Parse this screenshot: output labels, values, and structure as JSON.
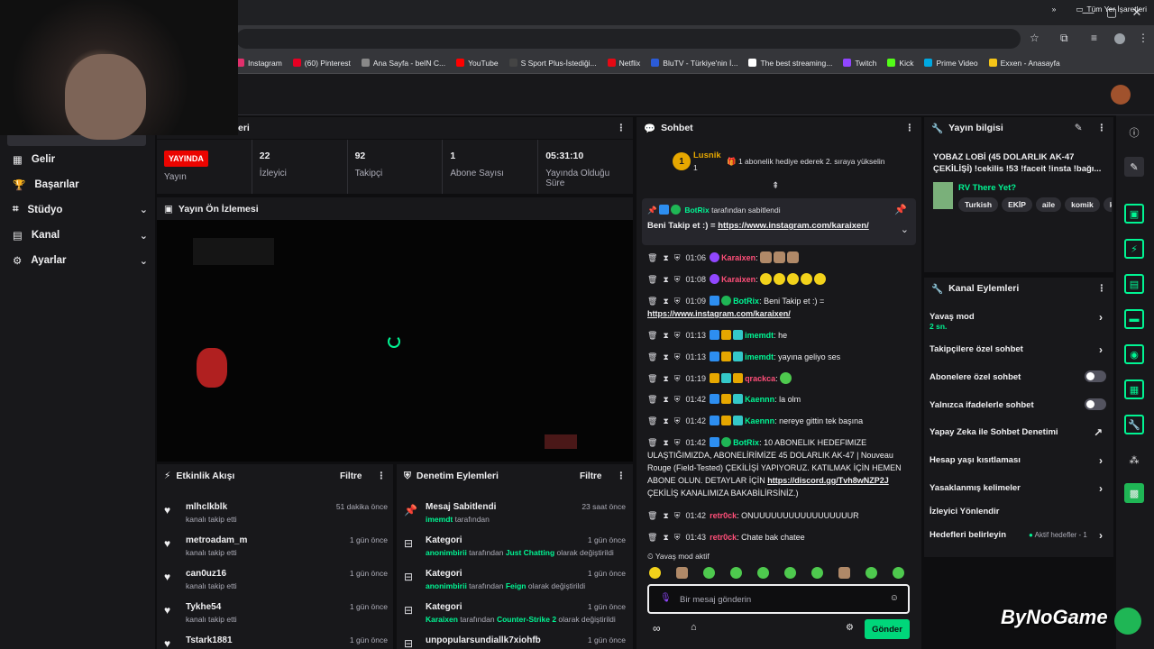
{
  "browser": {
    "bookmarks": [
      {
        "label": "Instagram",
        "color": "#e1306c"
      },
      {
        "label": "(60) Pinterest",
        "color": "#e60023"
      },
      {
        "label": "Ana Sayfa - beIN C...",
        "color": "#888888"
      },
      {
        "label": "YouTube",
        "color": "#ff0000"
      },
      {
        "label": "S Sport Plus-İstediği...",
        "color": "#444444"
      },
      {
        "label": "Netflix",
        "color": "#e50914"
      },
      {
        "label": "BluTV - Türkiye'nin İ...",
        "color": "#2b5bd7"
      },
      {
        "label": "The best streaming...",
        "color": "#ffffff"
      },
      {
        "label": "Twitch",
        "color": "#9146ff"
      },
      {
        "label": "Kick",
        "color": "#53fc18"
      },
      {
        "label": "Prime Video",
        "color": "#00a8e1"
      },
      {
        "label": "Exxen - Anasayfa",
        "color": "#f5c518"
      }
    ],
    "bookmarks_more": "»",
    "all_bookmarks": "Tüm Yer İşaretleri"
  },
  "sidebar": {
    "items": [
      {
        "label": "Gelir",
        "icon": "income-icon",
        "chevron": false
      },
      {
        "label": "Başarılar",
        "icon": "trophy-icon",
        "chevron": false
      },
      {
        "label": "Stüdyo",
        "icon": "studio-icon",
        "chevron": true
      },
      {
        "label": "Kanal",
        "icon": "channel-icon",
        "chevron": true
      },
      {
        "label": "Ayarlar",
        "icon": "settings-icon",
        "chevron": true
      }
    ]
  },
  "stream_panel": {
    "title_fragment": "eri",
    "stats": [
      {
        "value": "YAYINDA",
        "label": "Yayın"
      },
      {
        "value": "22",
        "label": "İzleyici"
      },
      {
        "value": "92",
        "label": "Takipçi"
      },
      {
        "value": "1",
        "label": "Abone Sayısı"
      },
      {
        "value": "05:31:10",
        "label": "Yayında Olduğu Süre"
      }
    ],
    "preview_title": "Yayın Ön İzlemesi"
  },
  "activity": {
    "title": "Etkinlik Akışı",
    "filter": "Filtre",
    "items": [
      {
        "name": "mlhclkblk",
        "sub": "kanalı takip etti",
        "time": "51 dakika önce"
      },
      {
        "name": "metroadam_m",
        "sub": "kanalı takip etti",
        "time": "1 gün önce"
      },
      {
        "name": "can0uz16",
        "sub": "kanalı takip etti",
        "time": "1 gün önce"
      },
      {
        "name": "Tykhe54",
        "sub": "kanalı takip etti",
        "time": "1 gün önce"
      },
      {
        "name": "Tstark1881",
        "sub": "",
        "time": "1 gün önce"
      }
    ]
  },
  "moderation": {
    "title": "Denetim Eylemleri",
    "filter": "Filtre",
    "items": [
      {
        "title": "Mesaj Sabitlendi",
        "actor": "imemdt",
        "mid": " tarafından",
        "target": "",
        "tail": "",
        "time": "23 saat önce",
        "icon": "pin-icon"
      },
      {
        "title": "Kategori",
        "actor": "anonimbirii",
        "mid": " tarafından ",
        "target": "Just Chatting",
        "tail": " olarak değiştirildi",
        "time": "1 gün önce",
        "icon": "category-icon"
      },
      {
        "title": "Kategori",
        "actor": "anonimbirii",
        "mid": " tarafından ",
        "target": "Feign",
        "tail": " olarak değiştirildi",
        "time": "1 gün önce",
        "icon": "category-icon"
      },
      {
        "title": "Kategori",
        "actor": "Karaixen",
        "mid": " tarafından ",
        "target": "Counter-Strike 2",
        "tail": " olarak değiştirildi",
        "time": "1 gün önce",
        "icon": "category-icon"
      },
      {
        "title": "unpopularsundiallk7xiohfb",
        "actor": "",
        "mid": "",
        "target": "",
        "tail": "",
        "time": "1 gün önce",
        "icon": "ban-icon"
      }
    ]
  },
  "chat": {
    "title": "Sohbet",
    "gifter": {
      "name": "Lusnik",
      "rank": "1",
      "count": "1",
      "text": "1 abonelik hediye ederek 2. sıraya yükselin"
    },
    "pinned": {
      "by": "BotRix",
      "by_suffix": " tarafından sabitlendi",
      "text": "Beni Takip et :) = ",
      "link": "https://www.instagram.com/karaixen/"
    },
    "messages": [
      {
        "time": "01:06",
        "user": "Karaixen",
        "color": "#ff4f79",
        "text": ""
      },
      {
        "time": "01:08",
        "user": "Karaixen",
        "color": "#ff4f79",
        "text": ""
      },
      {
        "time": "01:09",
        "user": "BotRix",
        "color": "#00f593",
        "text": "Beni Takip et :) =",
        "link": "https://www.instagram.com/karaixen/"
      },
      {
        "time": "01:13",
        "user": "imemdt",
        "color": "#00f593",
        "text": "he"
      },
      {
        "time": "01:13",
        "user": "imemdt",
        "color": "#00f593",
        "text": "yayına geliyo ses"
      },
      {
        "time": "01:19",
        "user": "qrackca",
        "color": "#ff4f79",
        "text": ""
      },
      {
        "time": "01:42",
        "user": "Kaennn",
        "color": "#00f593",
        "text": "la olm"
      },
      {
        "time": "01:42",
        "user": "Kaennn",
        "color": "#00f593",
        "text": "nereye gittin tek başına"
      },
      {
        "time": "01:42",
        "user": "BotRix",
        "color": "#00f593",
        "text": "10 ABONELIK HEDEFIMIZE ULAŞTIĞIMIZDA, ABONELİRİMİZE 45 DOLARLIK AK-47 | Nouveau Rouge (Field-Tested) ÇEKİLİŞİ YAPIYORUZ. KATILMAK İÇİN HEMEN ABONE OLUN. DETAYLAR İÇİN",
        "link": "https://discord.gg/Tvh8wNZP2J",
        "after": " ÇEKİLİŞ KANALIMIZA BAKABİLİRSİNİZ.)"
      },
      {
        "time": "01:42",
        "user": "retr0ck",
        "color": "#ff4f79",
        "text": "ONUUUUUUUUUUUUUUUUUR"
      },
      {
        "time": "01:43",
        "user": "retr0ck",
        "color": "#ff4f79",
        "text": "Chate bak chatee"
      }
    ],
    "slow_mode": "Yavaş mod aktif",
    "placeholder": "Bir mesaj gönderin",
    "send": "Gönder"
  },
  "stream_info": {
    "title": "Yayın bilgisi",
    "stream_title": "YOBAZ LOBİ (45 DOLARLIK AK-47 ÇEKİLİŞİ) !cekilis !53 !faceit !insta !bağı...",
    "game": "RV There Yet?",
    "tags": [
      "Turkish",
      "EKİP",
      "aile",
      "komik",
      "kx"
    ]
  },
  "channel_actions": {
    "title": "Kanal Eylemleri",
    "items": [
      {
        "label": "Yavaş mod",
        "sub": "2 sn.",
        "type": "arrow"
      },
      {
        "label": "Takipçilere özel sohbet",
        "type": "arrow"
      },
      {
        "label": "Abonelere özel sohbet",
        "type": "toggle"
      },
      {
        "label": "Yalnızca ifadelerle sohbet",
        "type": "toggle"
      },
      {
        "label": "Yapay Zeka ile Sohbet Denetimi",
        "type": "external"
      },
      {
        "label": "Hesap yaşı kısıtlaması",
        "type": "arrow"
      },
      {
        "label": "Yasaklanmış kelimeler",
        "type": "arrow"
      },
      {
        "label": "İzleyici Yönlendir",
        "type": "none"
      },
      {
        "label": "Hedefleri belirleyin",
        "status": "Aktif hedefler - 1",
        "type": "arrow"
      }
    ]
  },
  "watermark": "ByNoGame"
}
